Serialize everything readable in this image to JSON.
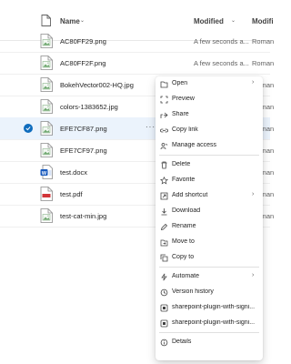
{
  "header": {
    "name_label": "Name",
    "name_sort_icon": "chevron-down-icon",
    "modified_label": "Modified",
    "modified_sort_icon": "chevron-down-icon",
    "modified_by_label": "Modifi"
  },
  "files": [
    {
      "name": "AC80FF29.png",
      "modified": "A few seconds a...",
      "by": "Roman",
      "type": "image",
      "selected": false
    },
    {
      "name": "AC80FF2F.png",
      "modified": "A few seconds a...",
      "by": "Roman",
      "type": "image",
      "selected": false
    },
    {
      "name": "BokehVector002-HQ.jpg",
      "modified": "",
      "by": "Roman",
      "type": "image",
      "selected": false
    },
    {
      "name": "colors-1383652.jpg",
      "modified": "",
      "by": "Roman",
      "type": "image",
      "selected": false
    },
    {
      "name": "EFE7CF87.png",
      "modified": "",
      "by": "Roman",
      "type": "image",
      "selected": true,
      "more": "···"
    },
    {
      "name": "EFE7CF97.png",
      "modified": "",
      "by": "Roman",
      "type": "image",
      "selected": false
    },
    {
      "name": "test.docx",
      "modified": "",
      "by": "Roman",
      "type": "word",
      "selected": false
    },
    {
      "name": "test.pdf",
      "modified": "",
      "by": "Roman",
      "type": "pdf",
      "selected": false
    },
    {
      "name": "test-cat-min.jpg",
      "modified": "",
      "by": "Roman",
      "type": "image",
      "selected": false
    }
  ],
  "context_menu": {
    "items": [
      {
        "label": "Open",
        "icon": "open-icon",
        "submenu": true
      },
      {
        "label": "Preview",
        "icon": "preview-icon",
        "submenu": false
      },
      {
        "label": "Share",
        "icon": "share-icon",
        "submenu": false
      },
      {
        "label": "Copy link",
        "icon": "link-icon",
        "submenu": false
      },
      {
        "label": "Manage access",
        "icon": "manage-access-icon",
        "submenu": false
      },
      {
        "label": "Delete",
        "icon": "delete-icon",
        "submenu": false
      },
      {
        "label": "Favorite",
        "icon": "star-icon",
        "submenu": false
      },
      {
        "label": "Add shortcut",
        "icon": "add-shortcut-icon",
        "submenu": true
      },
      {
        "label": "Download",
        "icon": "download-icon",
        "submenu": false
      },
      {
        "label": "Rename",
        "icon": "rename-icon",
        "submenu": false
      },
      {
        "label": "Move to",
        "icon": "move-icon",
        "submenu": false
      },
      {
        "label": "Copy to",
        "icon": "copy-icon",
        "submenu": false
      },
      {
        "label": "Automate",
        "icon": "automate-icon",
        "submenu": true
      },
      {
        "label": "Version history",
        "icon": "version-history-icon",
        "submenu": false
      },
      {
        "label": "sharepoint-plugin-with-signi...",
        "icon": "plugin-icon",
        "submenu": false
      },
      {
        "label": "sharepoint-plugin-with-signi...",
        "icon": "plugin-icon",
        "submenu": false
      },
      {
        "label": "Details",
        "icon": "details-icon",
        "submenu": false
      }
    ],
    "submenu_chevron": "›"
  },
  "colors": {
    "accent": "#0f6cbd",
    "selected_row": "#ebf3fc",
    "word": "#185abd",
    "pdf": "#d13438"
  }
}
